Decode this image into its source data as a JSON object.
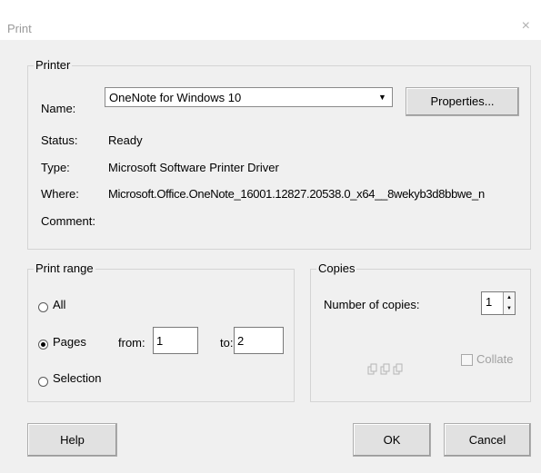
{
  "dialog": {
    "title": "Print",
    "close_glyph": "×"
  },
  "printer": {
    "group_label": "Printer",
    "name_label": "Name:",
    "name_value": "OneNote for Windows 10",
    "properties_button": "Properties...",
    "status_label": "Status:",
    "status_value": "Ready",
    "type_label": "Type:",
    "type_value": "Microsoft Software Printer Driver",
    "where_label": "Where:",
    "where_value": "Microsoft.Office.OneNote_16001.12827.20538.0_x64__8wekyb3d8bbwe_n",
    "comment_label": "Comment:",
    "comment_value": ""
  },
  "print_range": {
    "group_label": "Print range",
    "all_label": "All",
    "pages_label": "Pages",
    "selection_label": "Selection",
    "selected": "pages",
    "from_label": "from:",
    "from_value": "1",
    "to_label": "to:",
    "to_value": "2"
  },
  "copies": {
    "group_label": "Copies",
    "number_label": "Number of copies:",
    "number_value": "1",
    "collate_label": "Collate",
    "collate_checked": false
  },
  "buttons": {
    "help": "Help",
    "ok": "OK",
    "cancel": "Cancel"
  },
  "icons": {
    "dropdown": "dropdown-arrow-icon",
    "spin_up": "spin-up-icon",
    "spin_down": "spin-down-icon",
    "collate_pages": "collate-pages-icon"
  }
}
